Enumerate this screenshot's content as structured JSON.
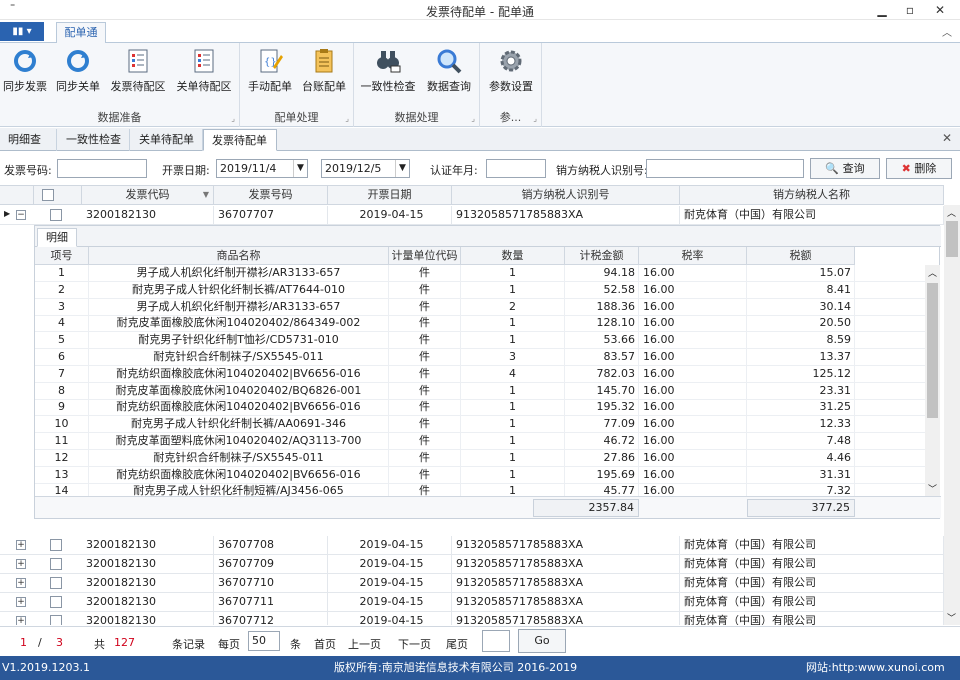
{
  "window": {
    "title": "发票待配单 - 配单通",
    "qa": "⁼"
  },
  "ribbon_tab": "配单通",
  "ribbon": {
    "groups": [
      {
        "label": "数据准备",
        "buttons": [
          "同步发票",
          "同步关单",
          "发票待配区",
          "关单待配区"
        ]
      },
      {
        "label": "配单处理",
        "buttons": [
          "手动配单",
          "台账配单"
        ]
      },
      {
        "label": "数据处理",
        "buttons": [
          "一致性检查",
          "数据查询"
        ]
      },
      {
        "label": "参...",
        "buttons": [
          "参数设置"
        ]
      }
    ]
  },
  "doc_tabs": [
    "明细查询",
    "一致性检查",
    "关单待配单",
    "发票待配单"
  ],
  "search": {
    "invoice_no_label": "发票号码:",
    "date_label": "开票日期:",
    "date_from": "2019/11/4",
    "date_to": "2019/12/5",
    "cert_label": "认证年月:",
    "seller_tax_label": "销方纳税人识别号:",
    "query_btn": "查询",
    "delete_btn": "删除"
  },
  "grid": {
    "headers": [
      "发票代码",
      "发票号码",
      "开票日期",
      "销方纳税人识别号",
      "销方纳税人名称"
    ],
    "rows": [
      [
        "3200182130",
        "36707707",
        "2019-04-15",
        "913205857178588 3XA",
        "耐克体育（中国）有限公司"
      ],
      [
        "3200182130",
        "36707708",
        "2019-04-15",
        "9132058571785883XA",
        "耐克体育（中国）有限公司"
      ],
      [
        "3200182130",
        "36707709",
        "2019-04-15",
        "9132058571785883XA",
        "耐克体育（中国）有限公司"
      ],
      [
        "3200182130",
        "36707710",
        "2019-04-15",
        "9132058571785883XA",
        "耐克体育（中国）有限公司"
      ],
      [
        "3200182130",
        "36707711",
        "2019-04-15",
        "9132058571785883XA",
        "耐克体育（中国）有限公司"
      ],
      [
        "3200182130",
        "36707712",
        "2019-04-15",
        "9132058571785883XA",
        "耐克体育（中国）有限公司"
      ]
    ]
  },
  "detail": {
    "tab": "明细",
    "headers": [
      "项号",
      "商品名称",
      "计量单位代码",
      "数量",
      "计税金额",
      "税率",
      "税额"
    ],
    "rows": [
      [
        "1",
        "男子成人机织化纤制开襟衫/AR3133-657",
        "件",
        "1",
        "94.18",
        "16.00",
        "15.07"
      ],
      [
        "2",
        "耐克男子成人针织化纤制长裤/AT7644-010",
        "件",
        "1",
        "52.58",
        "16.00",
        "8.41"
      ],
      [
        "3",
        "男子成人机织化纤制开襟衫/AR3133-657",
        "件",
        "2",
        "188.36",
        "16.00",
        "30.14"
      ],
      [
        "4",
        "耐克皮革面橡胶底休闲104020402/864349-002",
        "件",
        "1",
        "128.10",
        "16.00",
        "20.50"
      ],
      [
        "5",
        "耐克男子针织化纤制T恤衫/CD5731-010",
        "件",
        "1",
        "53.66",
        "16.00",
        "8.59"
      ],
      [
        "6",
        "耐克针织合纤制袜子/SX5545-011",
        "件",
        "3",
        "83.57",
        "16.00",
        "13.37"
      ],
      [
        "7",
        "耐克纺织面橡胶底休闲104020402|BV6656-016",
        "件",
        "4",
        "782.03",
        "16.00",
        "125.12"
      ],
      [
        "8",
        "耐克皮革面橡胶底休闲104020402/BQ6826-001",
        "件",
        "1",
        "145.70",
        "16.00",
        "23.31"
      ],
      [
        "9",
        "耐克纺织面橡胶底休闲104020402|BV6656-016",
        "件",
        "1",
        "195.32",
        "16.00",
        "31.25"
      ],
      [
        "10",
        "耐克男子成人针织化纤制长裤/AA0691-346",
        "件",
        "1",
        "77.09",
        "16.00",
        "12.33"
      ],
      [
        "11",
        "耐克皮革面塑料底休闲104020402/AQ3113-700",
        "件",
        "1",
        "46.72",
        "16.00",
        "7.48"
      ],
      [
        "12",
        "耐克针织合纤制袜子/SX5545-011",
        "件",
        "1",
        "27.86",
        "16.00",
        "4.46"
      ],
      [
        "13",
        "耐克纺织面橡胶底休闲104020402|BV6656-016",
        "件",
        "1",
        "195.69",
        "16.00",
        "31.31"
      ],
      [
        "14",
        "耐克男子成人针织化纤制短裤/AJ3456-065",
        "件",
        "1",
        "45.77",
        "16.00",
        "7.32"
      ]
    ],
    "total_amount": "2357.84",
    "total_tax": "377.25"
  },
  "pager": {
    "current": "1",
    "sep": "/",
    "pages": "3",
    "total_label": "共",
    "total": "127",
    "records_label": "条记录",
    "per_page_label": "每页",
    "per_page": "50",
    "unit": "条",
    "first": "首页",
    "prev": "上一页",
    "next": "下一页",
    "last": "尾页",
    "go": "Go"
  },
  "status": {
    "version": "V1.2019.1203.1",
    "copyright": "版权所有:南京旭诺信息技术有限公司 2016-2019",
    "website": "网站:http:www.xunoi.com"
  },
  "colors": {
    "accent": "#2a63b0",
    "status_bg": "#2b5898",
    "pager_red": "#d0021b"
  }
}
